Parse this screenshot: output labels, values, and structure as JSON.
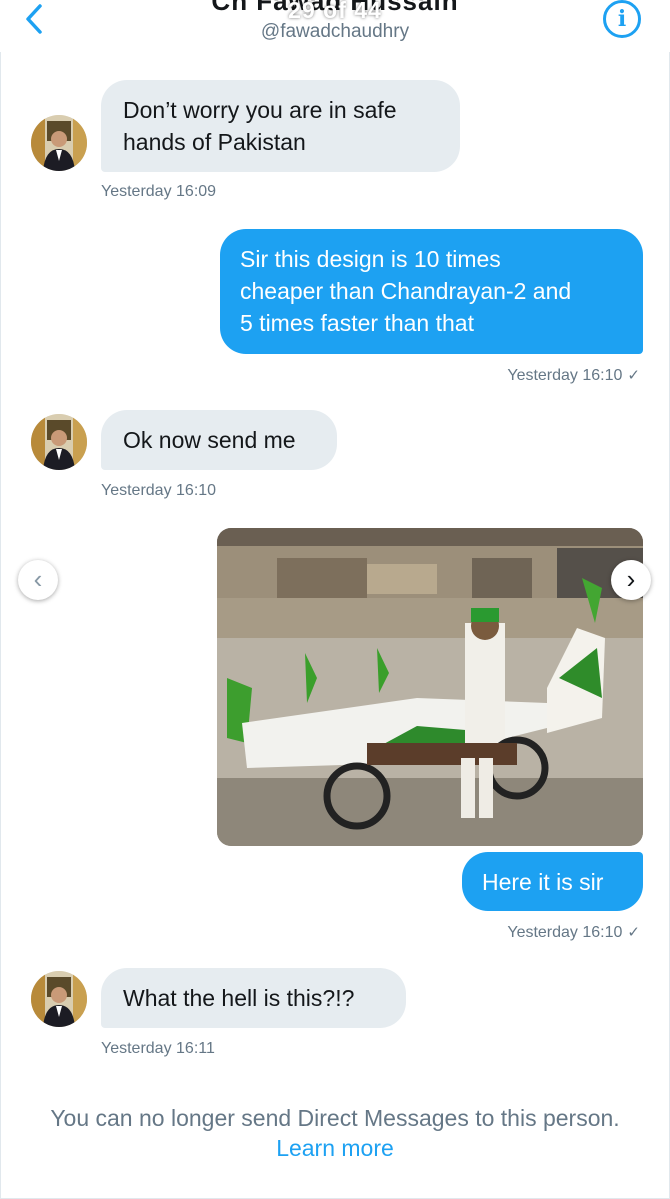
{
  "header": {
    "title": "Ch Fawad Hussain",
    "counter": "29 of 44",
    "handle": "@fawadchaudhry",
    "info_label": "i"
  },
  "messages": [
    {
      "side": "received",
      "text_lines": [
        "Don’t worry you are in safe",
        "hands of Pakistan"
      ],
      "time": "Yesterday 16:09"
    },
    {
      "side": "sent",
      "text_lines": [
        "Sir this design is 10 times",
        "cheaper than Chandrayan-2 and",
        "5 times faster than that"
      ],
      "time": "Yesterday 16:10",
      "status_icon": "✓"
    },
    {
      "side": "received",
      "text_lines": [
        "Ok now send me"
      ],
      "time": "Yesterday 16:10"
    },
    {
      "side": "sent",
      "media": "photo-motorbike-plane",
      "text_lines": [
        "Here it is sir"
      ],
      "time": "Yesterday 16:10",
      "status_icon": "✓"
    },
    {
      "side": "received",
      "text_lines": [
        "What the hell is this?!?"
      ],
      "time": "Yesterday 16:11"
    }
  ],
  "media_nav": {
    "prev": "‹",
    "next": "›"
  },
  "footer": {
    "notice": "You can no longer send Direct Messages to this person.",
    "link": "Learn more"
  },
  "colors": {
    "accent": "#1da1f2",
    "received_bubble": "#e6ecf0",
    "muted_text": "#657786"
  }
}
